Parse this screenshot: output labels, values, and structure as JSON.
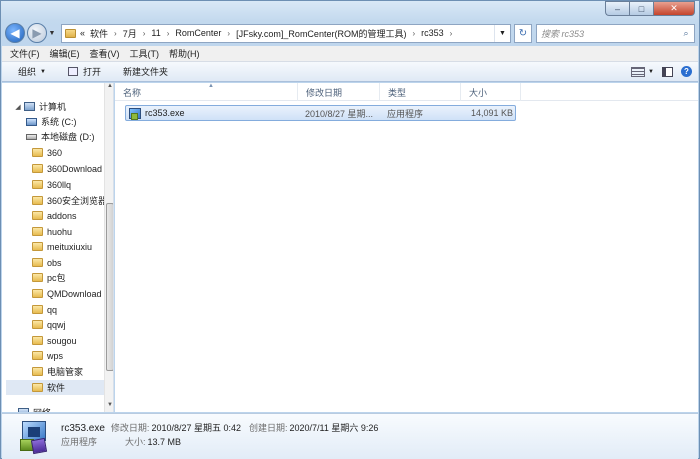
{
  "window": {
    "controls": {
      "minimize": "–",
      "maximize": "□",
      "close": "✕"
    }
  },
  "address": {
    "overflow": "«",
    "crumbs": [
      "软件",
      "7月",
      "11",
      "RomCenter",
      "[JFsky.com]_RomCenter(ROM的管理工具)",
      "rc353"
    ],
    "separator": "›",
    "search_placeholder": "搜索 rc353"
  },
  "menu": [
    "文件(F)",
    "编辑(E)",
    "查看(V)",
    "工具(T)",
    "帮助(H)"
  ],
  "toolbar": {
    "organize": "组织",
    "open": "打开",
    "new_folder": "新建文件夹",
    "help": "?"
  },
  "nav": {
    "computer": "计算机",
    "drives": [
      {
        "label": "系统 (C:)"
      },
      {
        "label": "本地磁盘 (D:)"
      }
    ],
    "folders": [
      "360",
      "360Download",
      "360llq",
      "360安全浏览器",
      "addons",
      "huohu",
      "meituxiuxiu",
      "obs",
      "pc包",
      "QMDownload",
      "qq",
      "qqwj",
      "sougou",
      "wps",
      "电脑管家",
      "软件"
    ],
    "selected_folder": "软件",
    "partial_item": "网络"
  },
  "columns": {
    "name": "名称",
    "modified": "修改日期",
    "type": "类型",
    "size": "大小"
  },
  "files": [
    {
      "name": "rc353.exe",
      "modified": "2010/8/27 星期...",
      "type": "应用程序",
      "size": "14,091 KB"
    }
  ],
  "details": {
    "name": "rc353.exe",
    "modified_label": "修改日期:",
    "modified_value": "2010/8/27 星期五 0:42",
    "created_label": "创建日期:",
    "created_value": "2020/7/11 星期六 9:26",
    "type": "应用程序",
    "size_label": "大小:",
    "size_value": "13.7 MB"
  }
}
